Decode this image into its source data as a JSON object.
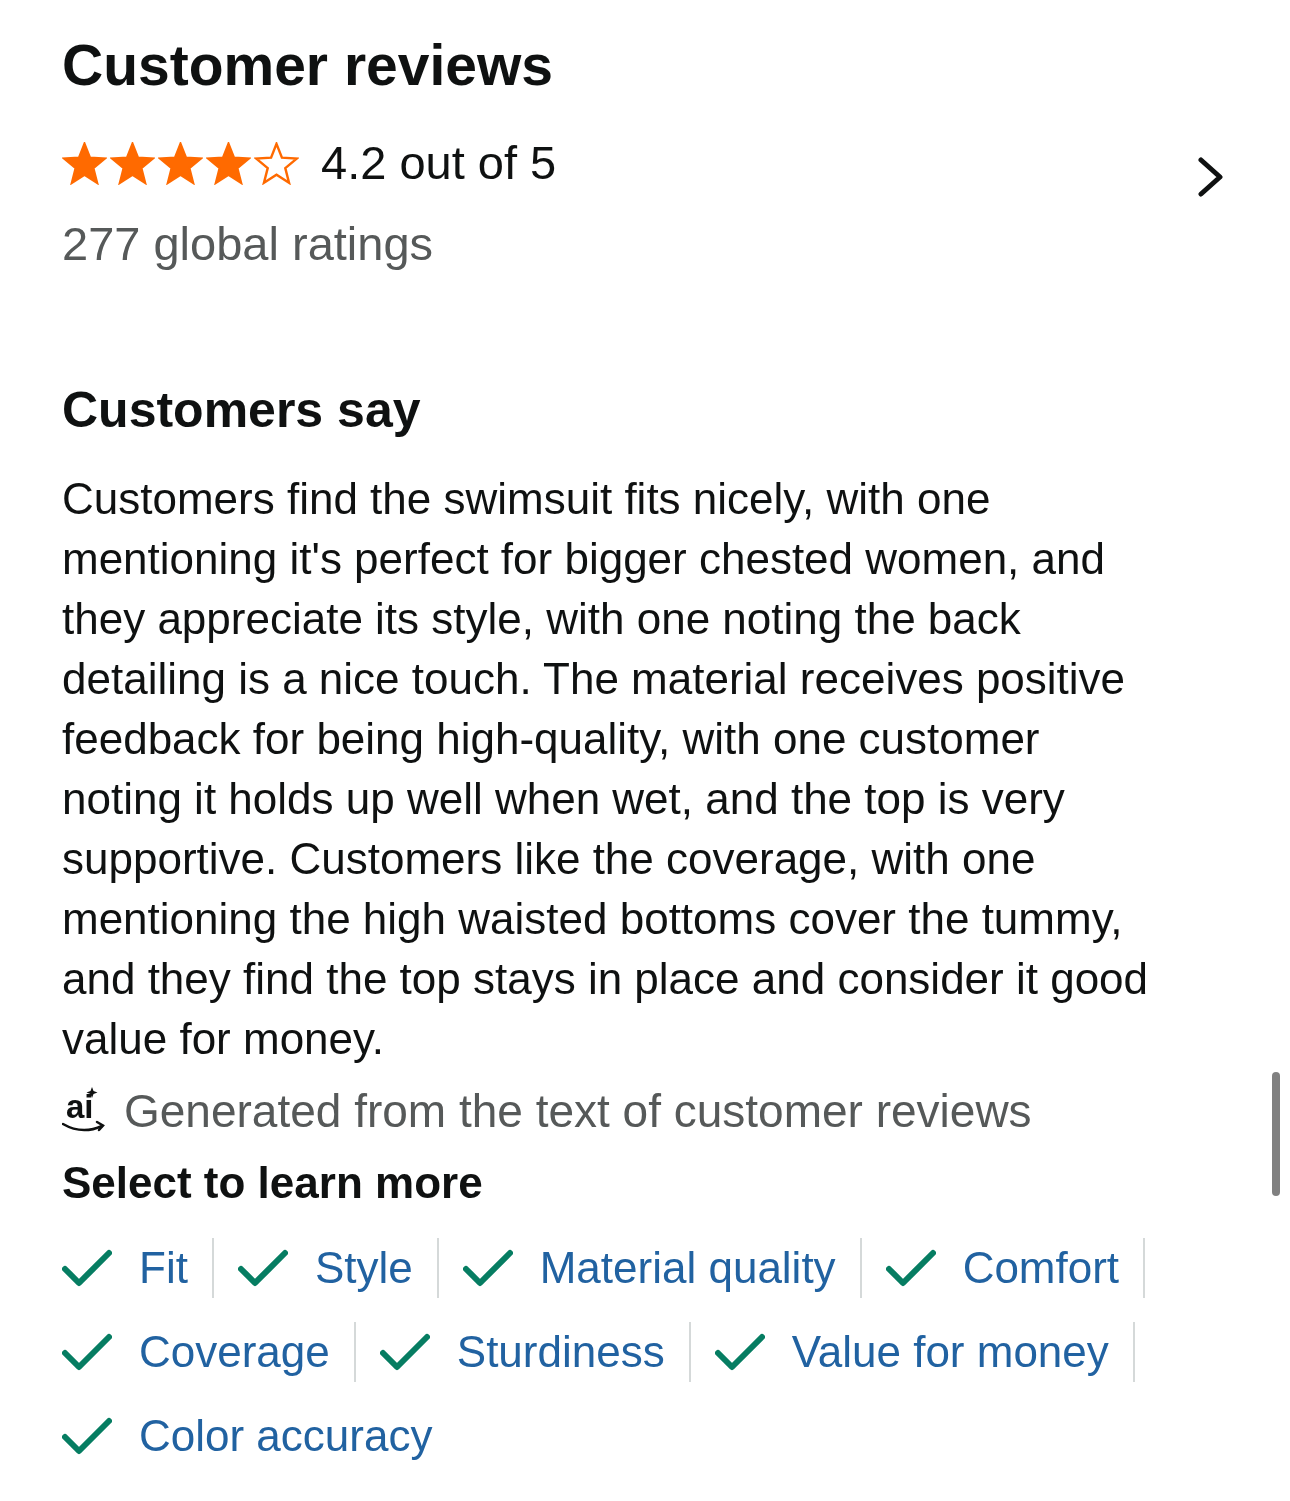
{
  "title": "Customer reviews",
  "rating": {
    "stars": 4,
    "summary": "4.2 out of 5",
    "count": "277 global ratings"
  },
  "customers_say": {
    "heading": "Customers say",
    "summary": "Customers find the swimsuit fits nicely, with one mentioning it's perfect for bigger chested women, and they appreciate its style, with one noting the back detailing is a nice touch. The material receives positive feedback for being high-quality, with one customer noting it holds up well when wet, and the top is very supportive. Customers like the coverage, with one mentioning the high waisted bottoms cover the tummy, and they find the top stays in place and consider it good value for money.",
    "ai_mark": "ai",
    "ai_note": "Generated from the text of customer reviews"
  },
  "aspects": {
    "heading": "Select to learn more",
    "items": [
      "Fit",
      "Style",
      "Material quality",
      "Comfort",
      "Coverage",
      "Sturdiness",
      "Value for money",
      "Color accuracy"
    ]
  }
}
